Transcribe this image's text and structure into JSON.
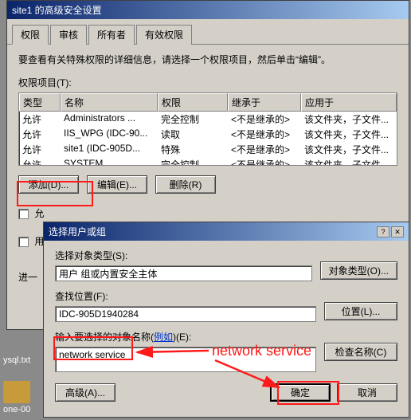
{
  "main": {
    "title": "site1 的高级安全设置",
    "tabs": [
      "权限",
      "审核",
      "所有者",
      "有效权限"
    ],
    "intro": "要查看有关特殊权限的详细信息，请选择一个权限项目，然后单击“编辑”。",
    "list_label": "权限项目(T):",
    "columns": [
      "类型",
      "名称",
      "权限",
      "继承于",
      "应用于"
    ],
    "rows": [
      {
        "type": "允许",
        "name": "Administrators ...",
        "perm": "完全控制",
        "inh": "<不是继承的>",
        "apply": "该文件夹，子文件..."
      },
      {
        "type": "允许",
        "name": "IIS_WPG (IDC-90...",
        "perm": "读取",
        "inh": "<不是继承的>",
        "apply": "该文件夹，子文件..."
      },
      {
        "type": "允许",
        "name": "site1 (IDC-905D...",
        "perm": "特殊",
        "inh": "<不是继承的>",
        "apply": "该文件夹，子文件..."
      },
      {
        "type": "允许",
        "name": "SYSTEM",
        "perm": "完全控制",
        "inh": "<不是继承的>",
        "apply": "该文件夹，子文件..."
      }
    ],
    "buttons": {
      "add": "添加(D)...",
      "edit": "编辑(E)...",
      "remove": "删除(R)"
    },
    "chk1_partial": "允",
    "chk2_partial": "用",
    "processing": "进一"
  },
  "sub": {
    "title": "选择用户或组",
    "object_type_label": "选择对象类型(S):",
    "object_type_value": "用户 组或内置安全主体",
    "object_type_btn": "对象类型(O)...",
    "location_label": "查找位置(F):",
    "location_value": "IDC-905D1940284",
    "location_btn": "位置(L)...",
    "names_label_prefix": "输入要选择的对象名称(",
    "names_label_link": "例如",
    "names_label_suffix": ")(E):",
    "names_value": "network service",
    "check_btn": "检查名称(C)",
    "advanced_btn": "高级(A)...",
    "ok_btn": "确定",
    "cancel_btn": "取消"
  },
  "annot_text": "network service",
  "desktop": {
    "file": "ysql.txt",
    "folder": "one-00"
  }
}
